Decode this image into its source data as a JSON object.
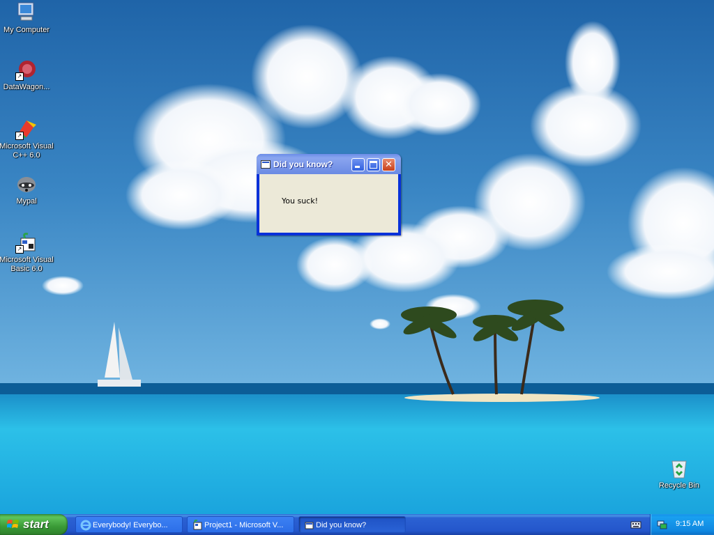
{
  "desktop": {
    "icons": [
      {
        "label": "My Computer",
        "icon": "my-computer-icon"
      },
      {
        "label": "DataWagon...",
        "icon": "datawagon-icon"
      },
      {
        "label": "Microsoft Visual C++ 6.0",
        "icon": "visual-cpp-icon"
      },
      {
        "label": "Mypal",
        "icon": "mypal-raccoon-icon"
      },
      {
        "label": "Microsoft Visual Basic 6.0",
        "icon": "visual-basic-icon"
      },
      {
        "label": "Recycle Bin",
        "icon": "recycle-bin-icon"
      }
    ]
  },
  "dialog": {
    "title": "Did you know?",
    "message": "You suck!",
    "buttons": {
      "minimize": "minimize",
      "maximize": "maximize",
      "close": "close"
    }
  },
  "taskbar": {
    "start_label": "start",
    "tasks": [
      {
        "label": "Everybody! Everybo...",
        "icon": "internet-explorer-icon",
        "active": false
      },
      {
        "label": "Project1 - Microsoft V...",
        "icon": "visual-basic-icon",
        "active": false
      },
      {
        "label": "Did you know?",
        "icon": "window-icon",
        "active": true
      }
    ],
    "clock": "9:15 AM"
  },
  "colors": {
    "titlebar": "#7c99ea",
    "window_frame": "#0831d9",
    "taskbar": "#2456cb",
    "start_button": "#3a9a37",
    "dialog_client": "#ece9d8"
  }
}
